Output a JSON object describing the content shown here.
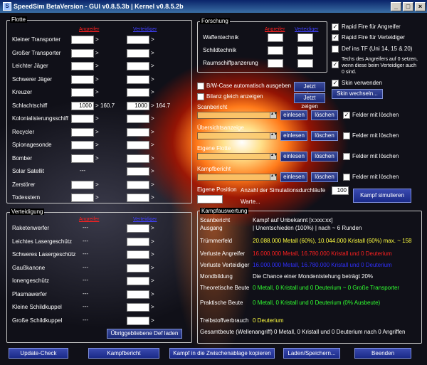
{
  "window": {
    "title": "SpeedSim BetaVersion - GUI v0.8.5.3b | Kernel v0.8.5.2b"
  },
  "flotte": {
    "title": "Flotte",
    "hdr_att": "Angreifer",
    "hdr_def": "Verteidiger",
    "rows": [
      {
        "label": "Kleiner Transporter",
        "att": "",
        "def": "",
        "att_res": "",
        "def_res": ""
      },
      {
        "label": "Großer Transporter",
        "att": "",
        "def": "",
        "att_res": "",
        "def_res": ""
      },
      {
        "label": "Leichter Jäger",
        "att": "",
        "def": "",
        "att_res": "",
        "def_res": ""
      },
      {
        "label": "Schwerer Jäger",
        "att": "",
        "def": "",
        "att_res": "",
        "def_res": ""
      },
      {
        "label": "Kreuzer",
        "att": "",
        "def": "",
        "att_res": "",
        "def_res": ""
      },
      {
        "label": "Schlachtschiff",
        "att": "1000",
        "def": "1000",
        "att_res": "160.7",
        "def_res": "164.7"
      },
      {
        "label": "Kolonialisierungsschiff",
        "att": "",
        "def": "",
        "att_res": "",
        "def_res": ""
      },
      {
        "label": "Recycler",
        "att": "",
        "def": "",
        "att_res": "",
        "def_res": ""
      },
      {
        "label": "Spionagesonde",
        "att": "",
        "def": "",
        "att_res": "",
        "def_res": ""
      },
      {
        "label": "Bomber",
        "att": "",
        "def": "",
        "att_res": "",
        "def_res": ""
      },
      {
        "label": "Solar Satellit",
        "att": "---",
        "def": "",
        "att_res": "",
        "def_res": ""
      },
      {
        "label": "Zerstörer",
        "att": "",
        "def": "",
        "att_res": "",
        "def_res": ""
      },
      {
        "label": "Todesstern",
        "att": "",
        "def": "",
        "att_res": "",
        "def_res": ""
      }
    ]
  },
  "verteidigung": {
    "title": "Verteidigung",
    "hdr_att": "Angreifer",
    "hdr_def": "Verteidiger",
    "rows": [
      "Raketenwerfer",
      "Leichtes Lasergeschütz",
      "Schweres Lasergeschütz",
      "Gaußkanone",
      "Ionengeschütz",
      "Plasmawerfer",
      "Kleine Schildkuppel",
      "Große Schildkuppel"
    ],
    "dash": "---",
    "restore_btn": "Übriggebliebene Def laden"
  },
  "forschung": {
    "title": "Forschung",
    "hdr_att": "Angreifer",
    "hdr_def": "Verteidiger",
    "rows": [
      "Waffentechnik",
      "Schildtechnik",
      "Raumschiffpanzerung"
    ]
  },
  "options": {
    "rapid_att": "Rapid Fire für Angreifer",
    "rapid_def": "Rapid Fire für Verteidiger",
    "def_tf": "Def ins TF (Uni 14, 15 & 20)",
    "techs": "Techs des Angreifers auf 0 setzen, wenn diese beim Verteidiger auch 0 sind.",
    "skin": "Skin verwenden",
    "skin_btn": "Skin wechseln...",
    "bw_case": "B/W-Case automatisch ausgeben",
    "bilanz": "Bilanz gleich anzeigen",
    "show_btn": "Jetzt zeigen"
  },
  "reports": {
    "items": [
      {
        "label": "Scanbericht"
      },
      {
        "label": "Übersichtsanzeige"
      },
      {
        "label": "Eigene Flotte"
      },
      {
        "label": "Kampfbericht"
      }
    ],
    "load": "einlesen",
    "clear": "löschen",
    "clear_fields": "Felder mit löschen"
  },
  "sim": {
    "own_pos": "Eigene Position",
    "runs_label": "Anzahl der Simulationsdurchläufe",
    "runs": "100",
    "sim_btn": "Kampf simulieren",
    "wait": "Warte..."
  },
  "kampf": {
    "title": "Kampfauswertung",
    "scan": "Scanbericht",
    "scan_val": "Kampf auf Unbekannt [x:xxx:xx]",
    "rows": [
      {
        "label": "Ausgang",
        "value": "| Unentschieden (100%) | nach ~ 6 Runden",
        "color": "#ffffff"
      },
      {
        "label": "Trümmerfeld",
        "value": "20.088.000 Metall (60%), 10.044.000 Kristall (60%) max. ~ 158",
        "color": "#ffff40"
      },
      {
        "label": "Verluste Angreifer",
        "value": "16.000.000 Metall, 16.780.000 Kristall und 0 Deuterium",
        "color": "#ff2020"
      },
      {
        "label": "Verluste Verteidiger",
        "value": "16.000.000 Metall, 16.780.000 Kristall und 0 Deuterium",
        "color": "#3030ff"
      },
      {
        "label": "Mondbildung",
        "value": "Die Chance einer Mondentstehung beträgt 20%",
        "color": "#ffffff"
      },
      {
        "label": "Theoretische Beute",
        "value": "0 Metall, 0 Kristall und 0 Deuterium ~ 0 Große Transporter",
        "color": "#30ff30"
      },
      {
        "label": "Praktische Beute",
        "value": "0 Metall, 0 Kristall und 0 Deuterium (0% Ausbeute)",
        "color": "#30ff30"
      },
      {
        "label": "Treibstoffverbrauch",
        "value": "0 Deuterium",
        "color": "#ffff40"
      },
      {
        "label": "Gesamtbeute (Wellenangriff)",
        "value": "0 Metall, 0 Kristall und 0 Deuterium nach 0 Angriffen",
        "color": "#ffffff"
      }
    ]
  },
  "bottom": {
    "update": "Update-Check",
    "kampfbericht": "Kampfbericht",
    "clipboard": "Kampf in die Zwischenablage kopieren",
    "load_save": "Laden/Speichern...",
    "quit": "Beenden"
  }
}
